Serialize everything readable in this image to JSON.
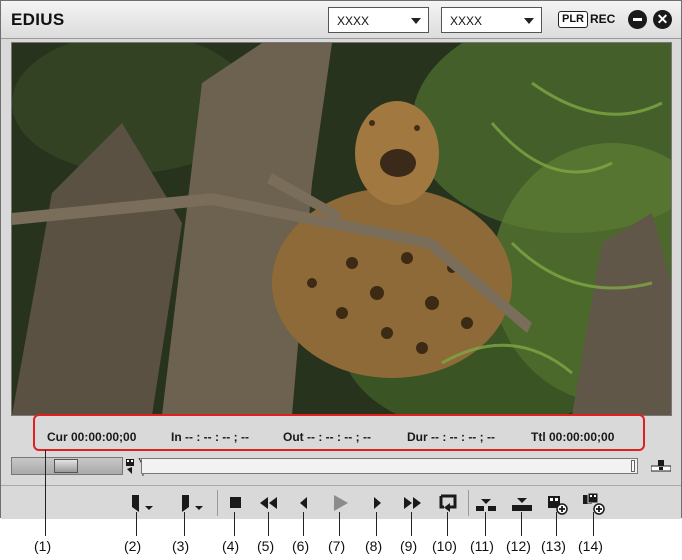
{
  "app": {
    "title": "EDIUS"
  },
  "dropdowns": [
    {
      "value": "XXXX"
    },
    {
      "value": "XXXX"
    }
  ],
  "status": {
    "plr": "PLR",
    "rec": "REC"
  },
  "timecode": {
    "cur": "Cur 00:00:00;00",
    "in": "In -- : -- : -- ; --",
    "out": "Out -- : -- : -- ; --",
    "dur": "Dur -- : -- : -- ; --",
    "ttl": "Ttl 00:00:00;00"
  },
  "toolbar": {
    "buttons": [
      {
        "name": "set-in-point",
        "icon": "in-point-icon"
      },
      {
        "name": "set-out-point",
        "icon": "out-point-icon"
      },
      {
        "name": "stop",
        "icon": "stop-icon"
      },
      {
        "name": "rewind",
        "icon": "rewind-icon"
      },
      {
        "name": "previous-frame",
        "icon": "previous-frame-icon"
      },
      {
        "name": "play",
        "icon": "play-icon"
      },
      {
        "name": "next-frame",
        "icon": "next-frame-icon"
      },
      {
        "name": "fast-forward",
        "icon": "fast-forward-icon"
      },
      {
        "name": "loop-playback",
        "icon": "loop-icon"
      },
      {
        "name": "insert-to-timeline",
        "icon": "insert-icon"
      },
      {
        "name": "overwrite-to-timeline",
        "icon": "overwrite-icon"
      },
      {
        "name": "add-to-bin",
        "icon": "add-bin-icon"
      },
      {
        "name": "add-clip",
        "icon": "add-clip-icon"
      }
    ]
  },
  "callouts": [
    "(1)",
    "(2)",
    "(3)",
    "(4)",
    "(5)",
    "(6)",
    "(7)",
    "(8)",
    "(9)",
    "(10)",
    "(11)",
    "(12)",
    "(13)",
    "(14)"
  ],
  "colors": {
    "highlight": "#e02020",
    "chrome": "#d9d9d9",
    "icon": "#1a1a1a"
  }
}
